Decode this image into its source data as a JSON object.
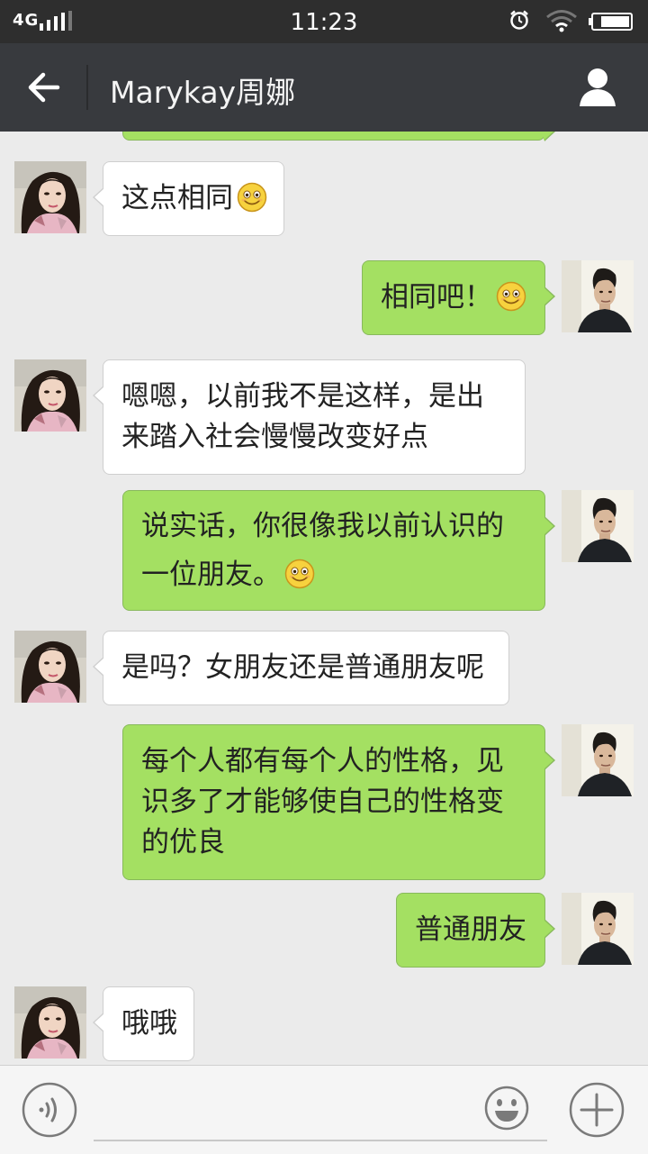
{
  "status_bar": {
    "network": "4G",
    "time": "11:23"
  },
  "header": {
    "contact_name": "Marykay周娜",
    "icons": [
      "back-arrow-icon",
      "profile-icon"
    ]
  },
  "messages": [
    {
      "side": "in",
      "text": "这点相同",
      "emoji": "smile-emoji-icon"
    },
    {
      "side": "out",
      "text": "相同吧！",
      "emoji": "smile-emoji-icon"
    },
    {
      "side": "in",
      "lines": [
        "嗯嗯，以前我不是这样，是出",
        "来踏入社会慢慢改变好点"
      ]
    },
    {
      "side": "out",
      "lines": [
        "说实话，你很像我以前认识的",
        "一位朋友。"
      ],
      "emoji": "smile-emoji-icon"
    },
    {
      "side": "in",
      "text": "是吗？女朋友还是普通朋友呢"
    },
    {
      "side": "out",
      "lines": [
        "每个人都有每个人的性格，见",
        "识多了才能够使自己的性格变",
        "的优良"
      ]
    },
    {
      "side": "out",
      "text": "普通朋友"
    },
    {
      "side": "in",
      "text": "哦哦"
    }
  ],
  "input_bar": {
    "icons": [
      "voice-icon",
      "emoji-icon",
      "plus-icon"
    ],
    "input_value": ""
  },
  "colors": {
    "status_bar": "#2e2e2e",
    "title_bar": "#383a3e",
    "chat_background": "#ebebeb",
    "outgoing_bubble": "#a4e062",
    "incoming_bubble": "#ffffff"
  }
}
